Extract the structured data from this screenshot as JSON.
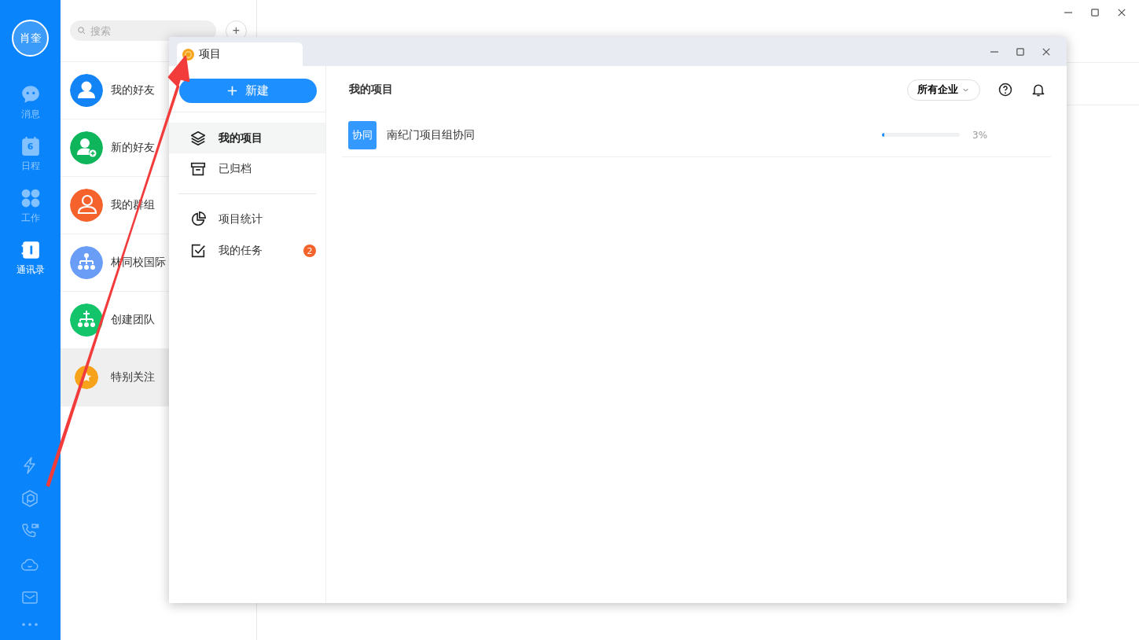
{
  "user": {
    "avatar_text": "肖奎"
  },
  "rail": {
    "items": [
      {
        "kind": "chat",
        "label": "消息",
        "selected": false
      },
      {
        "kind": "calendar",
        "label": "日程",
        "day": "6",
        "selected": false
      },
      {
        "kind": "apps",
        "label": "工作",
        "selected": false
      },
      {
        "kind": "contacts",
        "label": "通讯录",
        "selected": true
      }
    ],
    "more": "•••"
  },
  "contacts": {
    "search": {
      "placeholder": "搜索"
    },
    "add_button": "+",
    "items": [
      {
        "kind": "person",
        "name": "我的好友",
        "color": "#1384f5",
        "selected": false
      },
      {
        "kind": "person-add",
        "name": "新的好友",
        "color": "#0fb55a",
        "selected": false
      },
      {
        "kind": "group",
        "name": "我的群组",
        "color": "#f5622c",
        "selected": false
      },
      {
        "kind": "org",
        "name": "林同校国际",
        "color": "#6a9df5",
        "selected": false
      },
      {
        "kind": "org-add",
        "name": "创建团队",
        "color": "#14c46b",
        "selected": false
      },
      {
        "kind": "star",
        "name": "特别关注",
        "color": "#f7a21b",
        "selected": true
      }
    ]
  },
  "project_window": {
    "tab": "项目",
    "new_button": "新建",
    "nav_groups": [
      [
        {
          "kind": "layers",
          "label": "我的项目",
          "selected": true
        },
        {
          "kind": "archive",
          "label": "已归档",
          "selected": false
        }
      ],
      [
        {
          "kind": "chart",
          "label": "项目统计",
          "selected": false
        },
        {
          "kind": "task",
          "label": "我的任务",
          "badge": "2",
          "selected": false
        }
      ]
    ],
    "title": "我的项目",
    "filter": "所有企业",
    "projects": [
      {
        "tag": "协同",
        "name": "南纪门项目组协同",
        "level": 0.03,
        "reading": "3%"
      }
    ]
  }
}
